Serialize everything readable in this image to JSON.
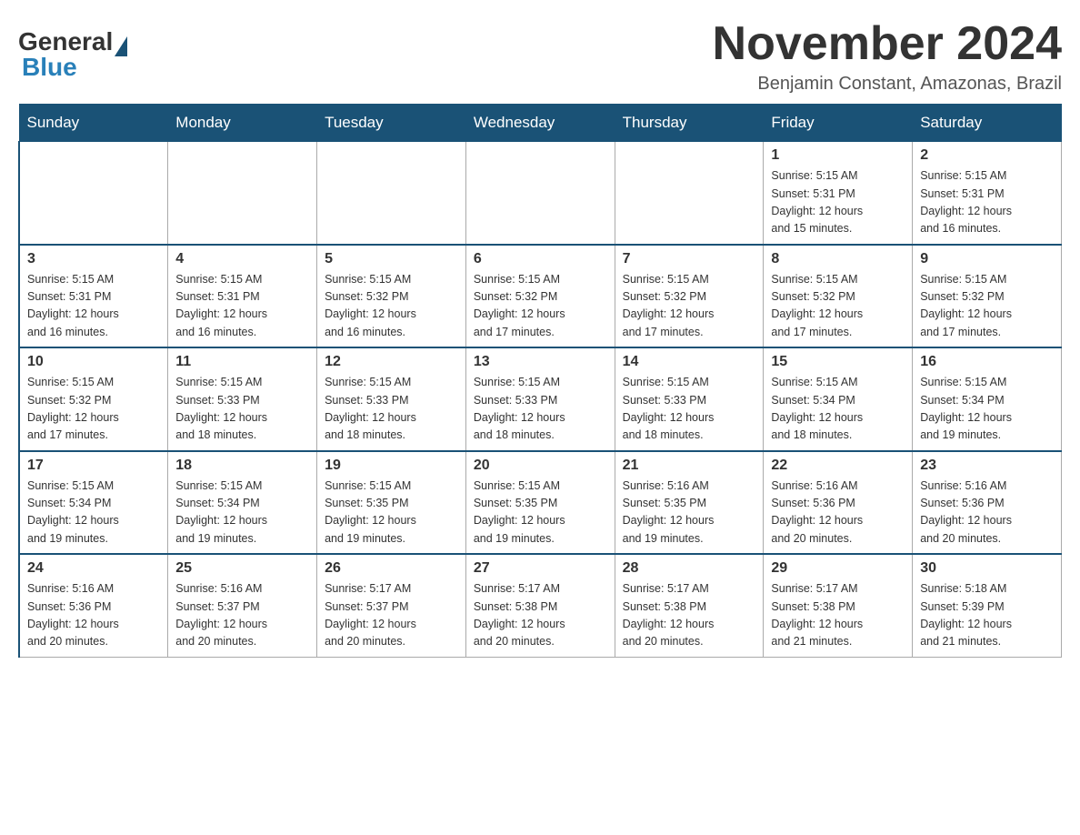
{
  "header": {
    "logo": {
      "text_general": "General",
      "triangle_symbol": "▲",
      "text_blue": "Blue"
    },
    "title": "November 2024",
    "subtitle": "Benjamin Constant, Amazonas, Brazil"
  },
  "calendar": {
    "days_of_week": [
      "Sunday",
      "Monday",
      "Tuesday",
      "Wednesday",
      "Thursday",
      "Friday",
      "Saturday"
    ],
    "weeks": [
      [
        {
          "day": "",
          "info": ""
        },
        {
          "day": "",
          "info": ""
        },
        {
          "day": "",
          "info": ""
        },
        {
          "day": "",
          "info": ""
        },
        {
          "day": "",
          "info": ""
        },
        {
          "day": "1",
          "info": "Sunrise: 5:15 AM\nSunset: 5:31 PM\nDaylight: 12 hours\nand 15 minutes."
        },
        {
          "day": "2",
          "info": "Sunrise: 5:15 AM\nSunset: 5:31 PM\nDaylight: 12 hours\nand 16 minutes."
        }
      ],
      [
        {
          "day": "3",
          "info": "Sunrise: 5:15 AM\nSunset: 5:31 PM\nDaylight: 12 hours\nand 16 minutes."
        },
        {
          "day": "4",
          "info": "Sunrise: 5:15 AM\nSunset: 5:31 PM\nDaylight: 12 hours\nand 16 minutes."
        },
        {
          "day": "5",
          "info": "Sunrise: 5:15 AM\nSunset: 5:32 PM\nDaylight: 12 hours\nand 16 minutes."
        },
        {
          "day": "6",
          "info": "Sunrise: 5:15 AM\nSunset: 5:32 PM\nDaylight: 12 hours\nand 17 minutes."
        },
        {
          "day": "7",
          "info": "Sunrise: 5:15 AM\nSunset: 5:32 PM\nDaylight: 12 hours\nand 17 minutes."
        },
        {
          "day": "8",
          "info": "Sunrise: 5:15 AM\nSunset: 5:32 PM\nDaylight: 12 hours\nand 17 minutes."
        },
        {
          "day": "9",
          "info": "Sunrise: 5:15 AM\nSunset: 5:32 PM\nDaylight: 12 hours\nand 17 minutes."
        }
      ],
      [
        {
          "day": "10",
          "info": "Sunrise: 5:15 AM\nSunset: 5:32 PM\nDaylight: 12 hours\nand 17 minutes."
        },
        {
          "day": "11",
          "info": "Sunrise: 5:15 AM\nSunset: 5:33 PM\nDaylight: 12 hours\nand 18 minutes."
        },
        {
          "day": "12",
          "info": "Sunrise: 5:15 AM\nSunset: 5:33 PM\nDaylight: 12 hours\nand 18 minutes."
        },
        {
          "day": "13",
          "info": "Sunrise: 5:15 AM\nSunset: 5:33 PM\nDaylight: 12 hours\nand 18 minutes."
        },
        {
          "day": "14",
          "info": "Sunrise: 5:15 AM\nSunset: 5:33 PM\nDaylight: 12 hours\nand 18 minutes."
        },
        {
          "day": "15",
          "info": "Sunrise: 5:15 AM\nSunset: 5:34 PM\nDaylight: 12 hours\nand 18 minutes."
        },
        {
          "day": "16",
          "info": "Sunrise: 5:15 AM\nSunset: 5:34 PM\nDaylight: 12 hours\nand 19 minutes."
        }
      ],
      [
        {
          "day": "17",
          "info": "Sunrise: 5:15 AM\nSunset: 5:34 PM\nDaylight: 12 hours\nand 19 minutes."
        },
        {
          "day": "18",
          "info": "Sunrise: 5:15 AM\nSunset: 5:34 PM\nDaylight: 12 hours\nand 19 minutes."
        },
        {
          "day": "19",
          "info": "Sunrise: 5:15 AM\nSunset: 5:35 PM\nDaylight: 12 hours\nand 19 minutes."
        },
        {
          "day": "20",
          "info": "Sunrise: 5:15 AM\nSunset: 5:35 PM\nDaylight: 12 hours\nand 19 minutes."
        },
        {
          "day": "21",
          "info": "Sunrise: 5:16 AM\nSunset: 5:35 PM\nDaylight: 12 hours\nand 19 minutes."
        },
        {
          "day": "22",
          "info": "Sunrise: 5:16 AM\nSunset: 5:36 PM\nDaylight: 12 hours\nand 20 minutes."
        },
        {
          "day": "23",
          "info": "Sunrise: 5:16 AM\nSunset: 5:36 PM\nDaylight: 12 hours\nand 20 minutes."
        }
      ],
      [
        {
          "day": "24",
          "info": "Sunrise: 5:16 AM\nSunset: 5:36 PM\nDaylight: 12 hours\nand 20 minutes."
        },
        {
          "day": "25",
          "info": "Sunrise: 5:16 AM\nSunset: 5:37 PM\nDaylight: 12 hours\nand 20 minutes."
        },
        {
          "day": "26",
          "info": "Sunrise: 5:17 AM\nSunset: 5:37 PM\nDaylight: 12 hours\nand 20 minutes."
        },
        {
          "day": "27",
          "info": "Sunrise: 5:17 AM\nSunset: 5:38 PM\nDaylight: 12 hours\nand 20 minutes."
        },
        {
          "day": "28",
          "info": "Sunrise: 5:17 AM\nSunset: 5:38 PM\nDaylight: 12 hours\nand 20 minutes."
        },
        {
          "day": "29",
          "info": "Sunrise: 5:17 AM\nSunset: 5:38 PM\nDaylight: 12 hours\nand 21 minutes."
        },
        {
          "day": "30",
          "info": "Sunrise: 5:18 AM\nSunset: 5:39 PM\nDaylight: 12 hours\nand 21 minutes."
        }
      ]
    ]
  }
}
